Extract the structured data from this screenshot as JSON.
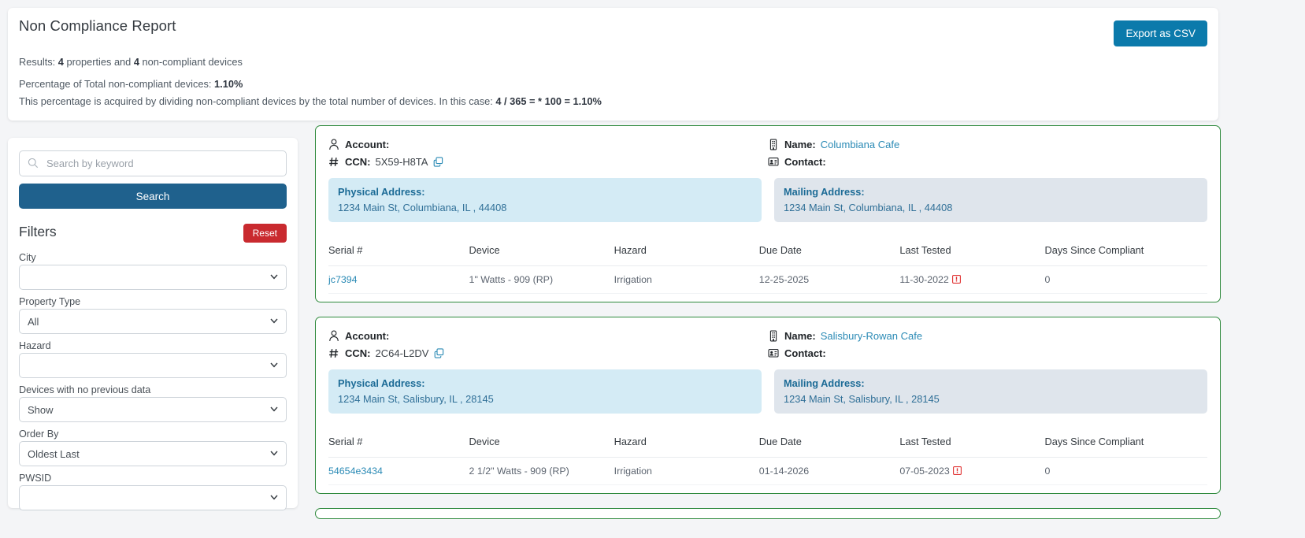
{
  "header": {
    "title": "Non Compliance Report",
    "export_label": "Export as CSV",
    "results_prefix": "Results: ",
    "results_count": "4",
    "results_mid": " properties and ",
    "results_devices": "4",
    "results_suffix": " non-compliant devices",
    "pct_label": "Percentage of Total non-compliant devices: ",
    "pct_value": "1.10%",
    "explain_prefix": "This percentage is acquired by dividing non-compliant devices by the total number of devices. In this case: ",
    "explain_formula": "4 / 365 = * 100 = 1.10%"
  },
  "sidebar": {
    "search": {
      "placeholder": "Search by keyword",
      "value": "",
      "icon": "search-icon",
      "button_label": "Search"
    },
    "filters_title": "Filters",
    "reset_label": "Reset",
    "fields": [
      {
        "label": "City",
        "value": "",
        "icon": "chevron-down-icon"
      },
      {
        "label": "Property Type",
        "value": "All",
        "icon": "chevron-down-icon"
      },
      {
        "label": "Hazard",
        "value": "",
        "icon": "chevron-down-icon"
      },
      {
        "label": "Devices with no previous data",
        "value": "Show",
        "icon": "chevron-down-icon"
      },
      {
        "label": "Order By",
        "value": "Oldest Last",
        "icon": "chevron-down-icon"
      },
      {
        "label": "PWSID",
        "value": "",
        "icon": "chevron-down-icon"
      }
    ]
  },
  "table_headers": {
    "serial": "Serial #",
    "device": "Device",
    "hazard": "Hazard",
    "due": "Due Date",
    "last": "Last Tested",
    "days": "Days Since Compliant"
  },
  "labels": {
    "account": "Account:",
    "ccn": "CCN:",
    "name": "Name:",
    "contact": "Contact:",
    "physical": "Physical Address:",
    "mailing": "Mailing Address:",
    "account_icon": "person-icon",
    "ccn_icon": "hash-icon",
    "name_icon": "building-icon",
    "contact_icon": "contact-card-icon",
    "copy_icon": "copy-icon",
    "warn_icon": "alert-square-icon"
  },
  "colors": {
    "accent_blue": "#0b7aab",
    "search_blue": "#1f618d",
    "reset_red": "#c92a2f",
    "card_green": "#2f8a3d",
    "link_blue": "#2a8ab5",
    "physical_bg": "#d4ebf5",
    "mailing_bg": "#dfe5ec",
    "warn_red": "#e03131"
  },
  "properties": [
    {
      "account": "",
      "ccn": "5X59-H8TA",
      "name": "Columbiana Cafe",
      "contact": "",
      "physical_address": "1234 Main St, Columbiana, IL , 44408",
      "mailing_address": "1234 Main St, Columbiana, IL , 44408",
      "devices": [
        {
          "serial": "jc7394",
          "device": "1\" Watts - 909 (RP)",
          "hazard": "Irrigation",
          "due_date": "12-25-2025",
          "last_tested": "11-30-2022",
          "last_tested_warning": true,
          "days_since_compliant": "0"
        }
      ]
    },
    {
      "account": "",
      "ccn": "2C64-L2DV",
      "name": "Salisbury-Rowan Cafe",
      "contact": "",
      "physical_address": "1234 Main St, Salisbury, IL , 28145",
      "mailing_address": "1234 Main St, Salisbury, IL , 28145",
      "devices": [
        {
          "serial": "54654e3434",
          "device": "2 1/2\" Watts - 909 (RP)",
          "hazard": "Irrigation",
          "due_date": "01-14-2026",
          "last_tested": "07-05-2023",
          "last_tested_warning": true,
          "days_since_compliant": "0"
        }
      ]
    }
  ]
}
